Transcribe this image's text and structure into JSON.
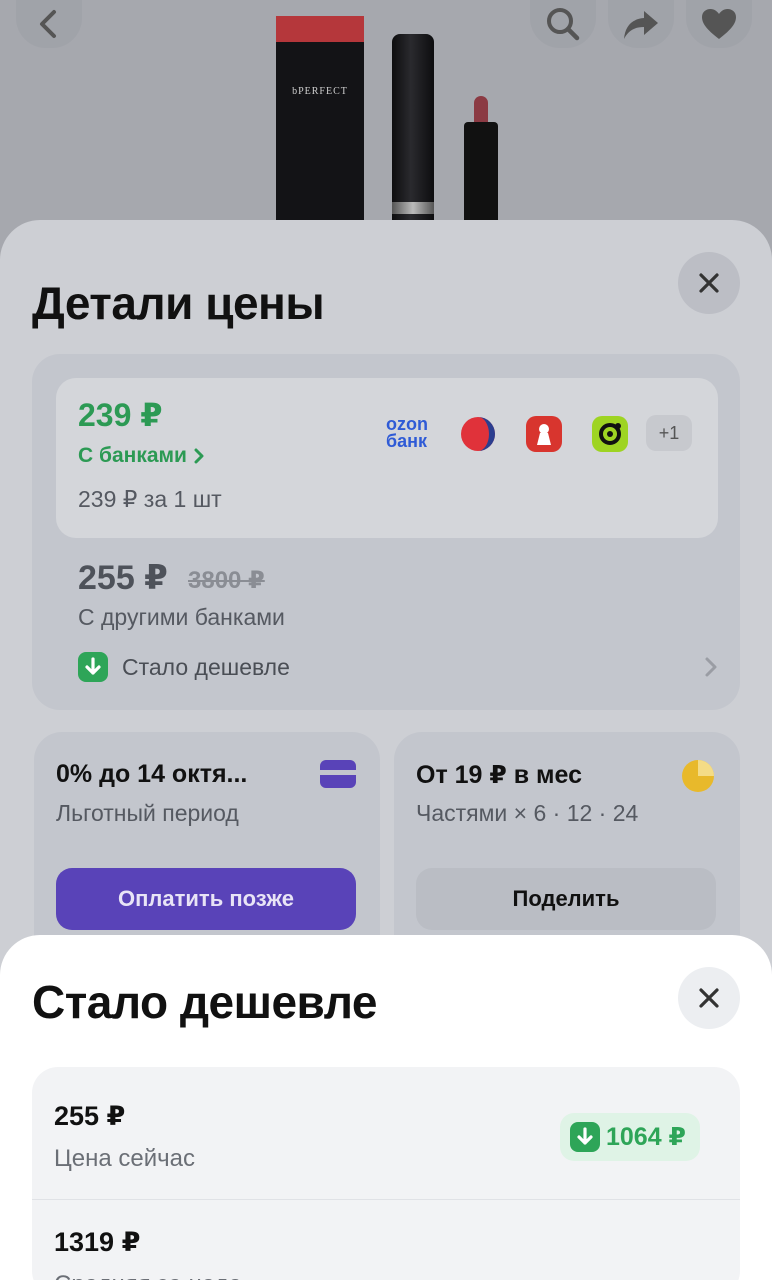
{
  "hero": {
    "brand_text": "bPERFECT"
  },
  "price_details": {
    "title": "Детали цены",
    "bank_price": "239 ₽",
    "bank_link": "С банками",
    "per_unit": "239 ₽ за 1 шт",
    "banks": [
      "ozon-bank-logo",
      "red-circle-bank-logo",
      "red-lion-bank-logo",
      "green-bank-logo"
    ],
    "ozon_line1": "ozon",
    "ozon_line2": "банк",
    "more_banks": "+1",
    "other_price": "255 ₽",
    "old_price": "3800 ₽",
    "other_banks_label": "С другими банками",
    "cheaper_label": "Стало дешевле"
  },
  "bnpl_card": {
    "title": "0% до 14 октя...",
    "subtitle": "Льготный период",
    "button": "Оплатить позже"
  },
  "installments_card": {
    "title": "От 19 ₽ в мес",
    "subtitle": "Частями × 6 · 12 · 24",
    "button": "Поделить"
  },
  "cheaper_sheet": {
    "title": "Стало дешевле",
    "current_price": "255 ₽",
    "current_label": "Цена сейчас",
    "drop_amount": "1064 ₽",
    "avg_price": "1319 ₽",
    "avg_label": "Средняя за неде"
  },
  "colors": {
    "accent_green": "#2c9a54",
    "button_purple": "#5943b8",
    "ozon_blue": "#2f5bd6"
  }
}
